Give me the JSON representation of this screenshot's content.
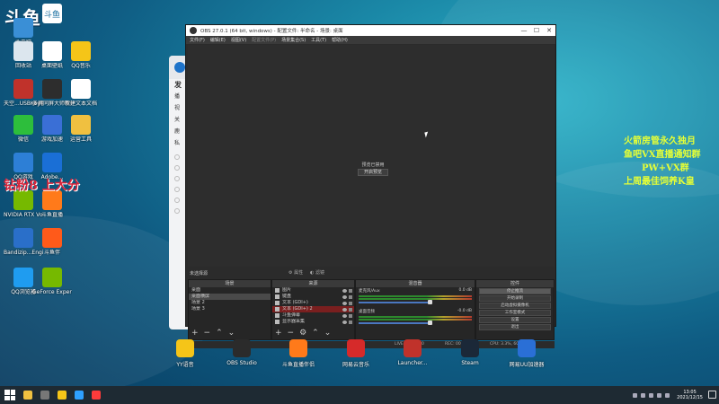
{
  "stream_logo": {
    "main": "斗鱼",
    "mini": "斗鱼"
  },
  "desktop_icons": [
    {
      "label": "此电脑",
      "color": "#3a8fd6"
    },
    {
      "label": "回收站",
      "color": "#dce6ee"
    },
    {
      "label": "桌面壁纸",
      "color": "#ffffff"
    },
    {
      "label": "QQ音乐",
      "color": "#f5c518"
    },
    {
      "label": "天空...USBKey管理",
      "color": "#c0322b"
    },
    {
      "label": "多屏同屏大师软件器",
      "color": "#2d2d2d"
    },
    {
      "label": "新建文本文档",
      "color": "#ffffff"
    },
    {
      "label": "微信",
      "color": "#2dbe3c"
    },
    {
      "label": "游戏加速",
      "color": "#3a6fd6"
    },
    {
      "label": "运营工具",
      "color": "#f0c040"
    },
    {
      "label": "QQ游戏",
      "color": "#2d7fd6"
    },
    {
      "label": "Adobe...",
      "color": "#1a6fd6"
    },
    {
      "label": "NVIDIA RTX Voice",
      "color": "#76b900"
    },
    {
      "label": "斗鱼直播",
      "color": "#ff7a1a"
    },
    {
      "label": "Bandizip...Engine",
      "color": "#2a6fc9"
    },
    {
      "label": "斗鱼伴",
      "color": "#ff5a1a"
    },
    {
      "label": "QQ浏览器",
      "color": "#1f9cf0"
    },
    {
      "label": "GeForce Experience",
      "color": "#76b900"
    }
  ],
  "overlay": {
    "left_text": "钻粉8 上大分",
    "right_lines": [
      "火箭房管永久独月",
      "鱼吧VX直播通知群",
      "PW+VX群",
      "上周最佳饲养K皇"
    ]
  },
  "bg_app": {
    "items": [
      "发",
      "播",
      "视",
      "关",
      "鹿",
      "私"
    ]
  },
  "obs": {
    "title": "OBS 27.0.1 (64 bit, windows) - 配置文件: 半命名 - 场景: 桌面",
    "window_buttons": [
      "—",
      "☐",
      "✕"
    ],
    "menu": [
      "文件(F)",
      "编辑(E)",
      "视图(V)",
      "配置文件(P)",
      "场景集合(S)",
      "工具(T)",
      "帮助(H)"
    ],
    "preview_msg": "预览已禁用",
    "preview_btn": "开启预览",
    "no_source": "未选择源",
    "props": "属性",
    "filters": "滤镜",
    "scenes": {
      "header": "场景",
      "items": [
        "桌面",
        "桌面横屏",
        "场景 2",
        "场景 3"
      ],
      "selected": 1
    },
    "sources": {
      "header": "来源",
      "items": [
        "图片",
        "键盘",
        "文本 (GDI+)",
        "文本 (GDI+) 2",
        "斗鱼弹幕",
        "显示器采集"
      ],
      "highlighted": 3
    },
    "mixer": {
      "header": "混音器",
      "channels": [
        {
          "name": "麦克风/Aux",
          "db": "0.0 dB"
        },
        {
          "name": "桌面音频",
          "db": "-0.0 dB"
        }
      ]
    },
    "controls": {
      "header": "控件",
      "buttons": [
        "停止推流",
        "开始录制",
        "启动虚拟摄像机",
        "工作室模式",
        "设置",
        "退出"
      ]
    },
    "status": {
      "live": "LIVE: 00:00:00",
      "rec": "REC: 00:00:00",
      "cpu": "CPU: 3.3%, 60.00 fps"
    }
  },
  "dock_apps": [
    {
      "label": "YY语音",
      "color": "#f5c518"
    },
    {
      "label": "OBS Studio",
      "color": "#2b2b2b"
    },
    {
      "label": "斗鱼直播伴侣",
      "color": "#ff7a1a"
    },
    {
      "label": "网易云音乐",
      "color": "#d62a2a"
    },
    {
      "label": "Launcher...",
      "color": "#c0322b"
    },
    {
      "label": "Steam",
      "color": "#1b2838"
    },
    {
      "label": "网易UU加速器",
      "color": "#2a6fd6"
    }
  ],
  "taskbar": {
    "pinned_colors": [
      "#f0c040",
      "#777777",
      "#f5c518",
      "#2ea0ff",
      "#ff3b3b"
    ],
    "time": "13:05",
    "date": "2021/12/15"
  }
}
